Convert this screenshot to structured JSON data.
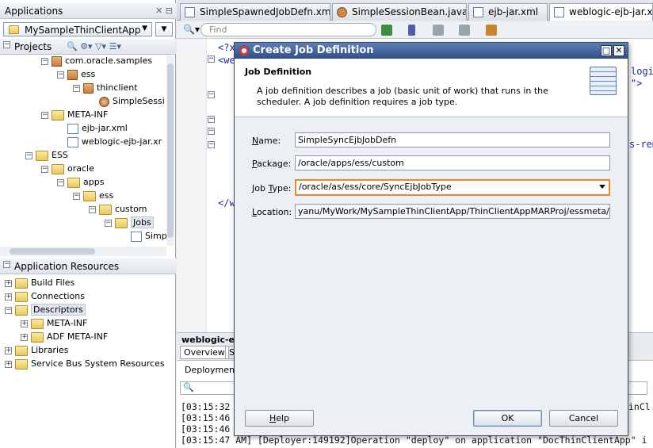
{
  "left_panel": {
    "applications_title": "Applications",
    "app_selector": "MySampleThinClientApp",
    "projects_title": "Projects",
    "tree": [
      {
        "label": "com.oracle.samples",
        "icon": "package-icon",
        "indent": 3
      },
      {
        "label": "ess",
        "icon": "package-icon",
        "indent": 4
      },
      {
        "label": "thinclient",
        "icon": "package-icon",
        "indent": 5
      },
      {
        "label": "SimpleSessi",
        "icon": "bean-icon",
        "indent": 6
      },
      {
        "label": "META-INF",
        "icon": "folder-icon",
        "indent": 3
      },
      {
        "label": "ejb-jar.xml",
        "icon": "xml-file-icon",
        "indent": 4
      },
      {
        "label": "weblogic-ejb-jar.xr",
        "icon": "xml-file-icon",
        "indent": 4
      },
      {
        "label": "ESS",
        "icon": "folder-icon",
        "indent": 2
      },
      {
        "label": "oracle",
        "icon": "folder-icon",
        "indent": 3
      },
      {
        "label": "apps",
        "icon": "folder-icon",
        "indent": 4
      },
      {
        "label": "ess",
        "icon": "folder-icon",
        "indent": 5
      },
      {
        "label": "custom",
        "icon": "folder-icon",
        "indent": 6
      },
      {
        "label": "Jobs",
        "icon": "folder-icon",
        "indent": 7
      },
      {
        "label": "Simp",
        "icon": "xml-file-icon",
        "indent": 8
      }
    ],
    "app_resources_title": "Application Resources",
    "resources": [
      {
        "label": "Build Files",
        "indent": 0
      },
      {
        "label": "Connections",
        "indent": 0
      },
      {
        "label": "Descriptors",
        "indent": 0
      },
      {
        "label": "META-INF",
        "indent": 1
      },
      {
        "label": "ADF META-INF",
        "indent": 1
      },
      {
        "label": "Libraries",
        "indent": 0
      },
      {
        "label": "Service Bus System Resources",
        "indent": 0
      }
    ]
  },
  "editor_tabs": [
    {
      "label": "SimpleSpawnedJobDefn.xml"
    },
    {
      "label": "SimpleSessionBean.java"
    },
    {
      "label": "ejb-jar.xml"
    },
    {
      "label": "weblogic-ejb-jar.xm"
    }
  ],
  "editor_toolbar": {
    "find_placeholder": "Find"
  },
  "editor_code": {
    "line1": "<?x",
    "line2": "<we",
    "line3": "</w",
    "right1": "logic",
    "right2": "\">",
    "right3": "s-rem"
  },
  "bottom": {
    "file_label": "weblogic-e",
    "overview_tab": "Overview",
    "s_tab": "S",
    "deployment_tab": "Deployment",
    "log_lines": [
      "[03:15:32",
      "[03:15:46",
      "[03:15:46",
      "[03:15:47 AM] [Deployer:149192]Operation \"deploy\" on application \"DocThinClientApp\" i"
    ],
    "log_right": "inCl"
  },
  "dialog": {
    "title": "Create Job Definition",
    "header_title": "Job Definition",
    "header_desc": "A job definition describes a job (basic unit of work) that runs in the scheduler. A job definition requires a job type.",
    "name_label_pre": "",
    "name_label_u": "N",
    "name_label_post": "ame:",
    "name_value": "SimpleSyncEjbJobDefn",
    "package_label_pre": "",
    "package_label_u": "P",
    "package_label_post": "ackage:",
    "package_value": "/oracle/apps/ess/custom",
    "jobtype_label_pre": "Job ",
    "jobtype_label_u": "T",
    "jobtype_label_post": "ype:",
    "jobtype_value": "/oracle/as/ess/core/SyncEjbJobType",
    "location_label_pre": "",
    "location_label_u": "L",
    "location_label_post": "ocation:",
    "location_value": "yanu/MyWork/MySampleThinClientApp/ThinClientAppMARProj/essmeta/",
    "help_label_pre": "",
    "help_label_u": "H",
    "help_label_post": "elp",
    "ok_label": "OK",
    "cancel_label": "Cancel"
  }
}
